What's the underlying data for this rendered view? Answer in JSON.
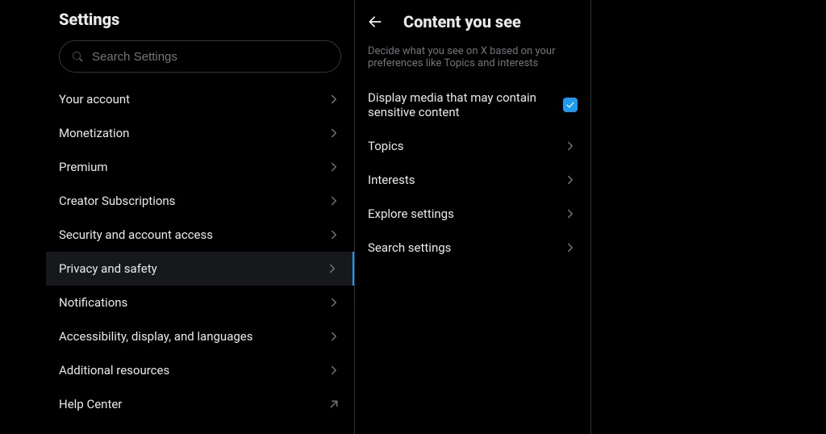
{
  "sidebar": {
    "title": "Settings",
    "search_placeholder": "Search Settings",
    "items": [
      {
        "label": "Your account",
        "active": false,
        "external": false
      },
      {
        "label": "Monetization",
        "active": false,
        "external": false
      },
      {
        "label": "Premium",
        "active": false,
        "external": false
      },
      {
        "label": "Creator Subscriptions",
        "active": false,
        "external": false
      },
      {
        "label": "Security and account access",
        "active": false,
        "external": false
      },
      {
        "label": "Privacy and safety",
        "active": true,
        "external": false
      },
      {
        "label": "Notifications",
        "active": false,
        "external": false
      },
      {
        "label": "Accessibility, display, and languages",
        "active": false,
        "external": false
      },
      {
        "label": "Additional resources",
        "active": false,
        "external": false
      },
      {
        "label": "Help Center",
        "active": false,
        "external": true
      }
    ]
  },
  "main": {
    "title": "Content you see",
    "description": "Decide what you see on X based on your preferences like Topics and interests",
    "items": [
      {
        "label": "Display media that may contain sensitive content",
        "type": "checkbox",
        "checked": true
      },
      {
        "label": "Topics",
        "type": "nav"
      },
      {
        "label": "Interests",
        "type": "nav"
      },
      {
        "label": "Explore settings",
        "type": "nav"
      },
      {
        "label": "Search settings",
        "type": "nav"
      }
    ]
  }
}
